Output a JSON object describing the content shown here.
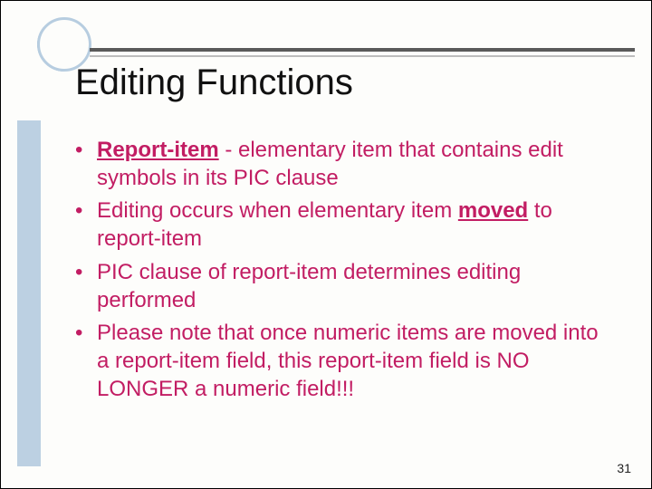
{
  "slide": {
    "title": "Editing Functions",
    "pageNumber": "31"
  },
  "bullets": [
    {
      "term": "Report-item",
      "rest": " - elementary item that contains edit symbols in its PIC clause"
    },
    {
      "prefix": "Editing occurs when elementary item ",
      "bold": "moved",
      "suffix": " to report-item"
    },
    {
      "text": "PIC clause of report-item determines editing performed"
    },
    {
      "text": "Please note that once numeric items are moved into a report-item field, this report-item field is NO LONGER a numeric field!!!"
    }
  ]
}
